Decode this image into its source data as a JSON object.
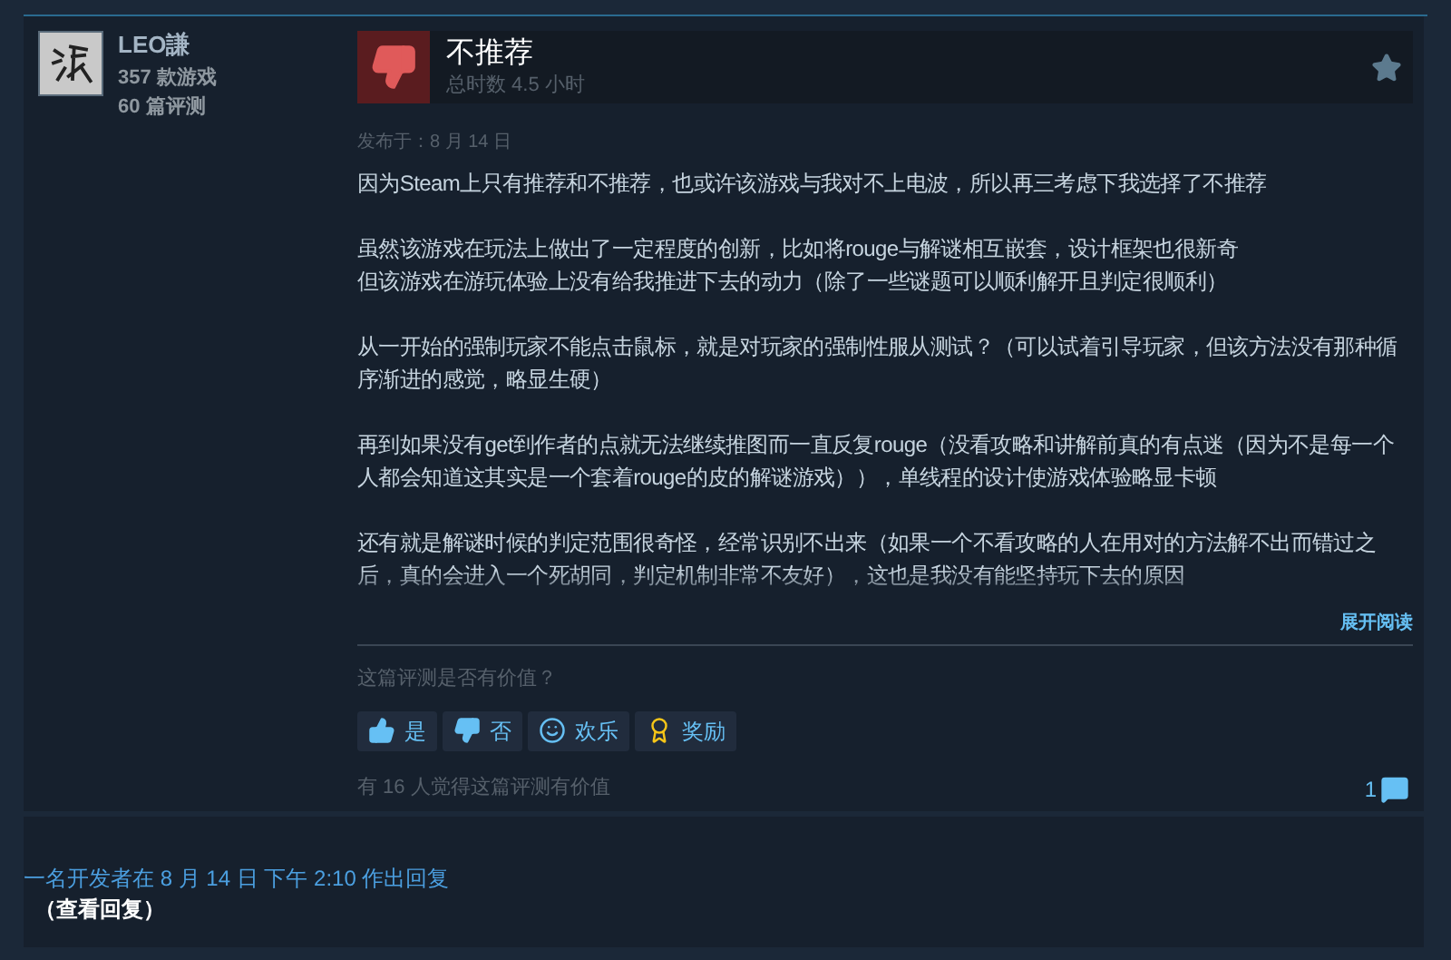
{
  "author": {
    "name": "LEO謙",
    "games": "357 款游戏",
    "reviews": "60 篇评测"
  },
  "review": {
    "verdict": "不推荐",
    "recommended": false,
    "playtime": "总时数 4.5 小时",
    "posted": "发布于：8 月 14 日",
    "paragraphs": [
      [
        "因为Steam上只有推荐和不推荐，也或许该游戏与我对不上电波，所以再三考虑下我选择了不推荐"
      ],
      [
        "虽然该游戏在玩法上做出了一定程度的创新，比如将rouge与解谜相互嵌套，设计框架也很新奇",
        "但该游戏在游玩体验上没有给我推进下去的动力（除了一些谜题可以顺利解开且判定很顺利）"
      ],
      [
        "从一开始的强制玩家不能点击鼠标，就是对玩家的强制性服从测试？（可以试着引导玩家，但该方法没有那种循序渐进的感觉，略显生硬）"
      ],
      [
        "再到如果没有get到作者的点就无法继续推图而一直反复rouge（没看攻略和讲解前真的有点迷（因为不是每一个人都会知道这其实是一个套着rouge的皮的解谜游戏）），单线程的设计使游戏体验略显卡顿"
      ],
      [
        "还有就是解谜时候的判定范围很奇怪，经常识别不出来（如果一个不看攻略的人在用对的方法解不出而错过之后，真的会进入一个死胡同，判定机制非常不友好），这也是我没有能坚持玩下去的原因"
      ]
    ],
    "expand": "展开阅读"
  },
  "helpful": {
    "question": "这篇评测是否有价值？",
    "buttons": [
      {
        "kind": "yes",
        "label": "是"
      },
      {
        "kind": "no",
        "label": "否"
      },
      {
        "kind": "funny",
        "label": "欢乐"
      },
      {
        "kind": "award",
        "label": "奖励"
      }
    ],
    "summary": "有 16 人觉得这篇评测有价值",
    "comments": "1"
  },
  "developer_reply": {
    "text": "一名开发者在 8 月 14 日 下午 2:10 作出回复",
    "link": "（查看回复）"
  }
}
